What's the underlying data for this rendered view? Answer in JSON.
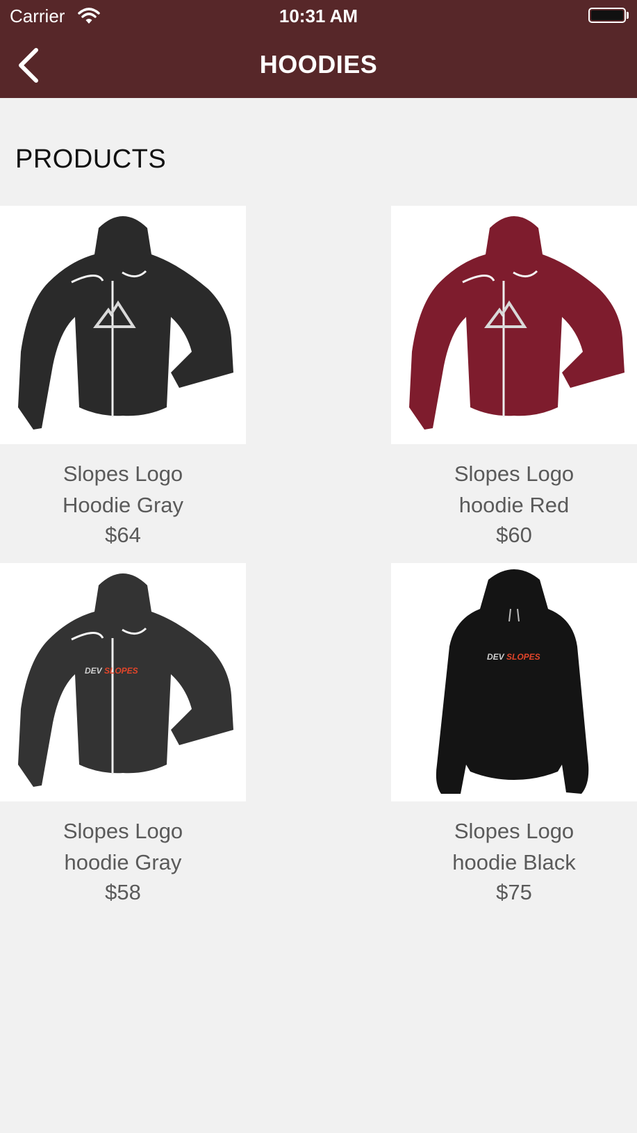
{
  "status_bar": {
    "carrier": "Carrier",
    "time": "10:31 AM"
  },
  "nav": {
    "title": "HOODIES",
    "back_icon": "chevron-left-icon"
  },
  "section": {
    "title": "PRODUCTS"
  },
  "products": [
    {
      "title": "Slopes Logo Hoodie Gray",
      "price": "$64",
      "color": "#2a2a2a",
      "logo": "mountain"
    },
    {
      "title": "Slopes Logo hoodie Red",
      "price": "$60",
      "color": "#7e1c2d",
      "logo": "mountain"
    },
    {
      "title": "Slopes Logo hoodie Gray",
      "price": "$58",
      "color": "#333333",
      "logo": "devslopes"
    },
    {
      "title": "Slopes Logo hoodie Black",
      "price": "$75",
      "color": "#141414",
      "logo": "devslopes"
    }
  ],
  "colors": {
    "nav_background": "#572729",
    "page_background": "#f1f1f1",
    "text_muted": "#5a5a5a"
  }
}
